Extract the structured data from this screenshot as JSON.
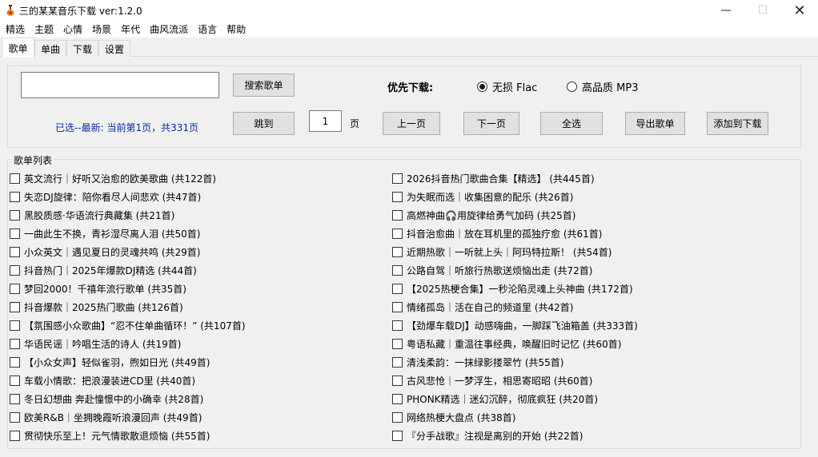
{
  "window": {
    "title": "三的某某音乐下载 ver:1.2.0",
    "min_glyph": "—",
    "max_glyph": "☐",
    "close_glyph": "✕",
    "icon": "guitar-app-icon"
  },
  "menu": [
    "精选",
    "主题",
    "心情",
    "场景",
    "年代",
    "曲风流派",
    "语言",
    "帮助"
  ],
  "tabs": [
    {
      "label": "歌单",
      "active": true
    },
    {
      "label": "单曲",
      "active": false
    },
    {
      "label": "下载",
      "active": false
    },
    {
      "label": "设置",
      "active": false
    }
  ],
  "search": {
    "value": "",
    "button": "搜索歌单"
  },
  "priority": {
    "label": "优先下载:",
    "options": [
      {
        "label": "无损 Flac",
        "checked": true
      },
      {
        "label": "高品质 MP3",
        "checked": false
      }
    ]
  },
  "status": "已选--最新:  当前第1页，共331页",
  "pager": {
    "jump": "跳到",
    "page_value": "1",
    "page_unit": "页",
    "prev": "上一页",
    "next": "下一页",
    "select_all": "全选",
    "export": "导出歌单",
    "add_download": "添加到下载"
  },
  "playlist_group": {
    "title": "歌单列表",
    "left": [
      "英文流行｜好听又治愈的欧美歌曲 (共122首)",
      "失恋DJ旋律：陪你看尽人间悲欢 (共47首)",
      "黑胶质感·华语流行典藏集 (共21首)",
      "一曲此生不换，青衫湿尽离人泪 (共50首)",
      "小众英文｜遇见夏日的灵魂共鸣 (共29首)",
      "抖音热门｜2025年爆款DJ精选 (共44首)",
      "梦回2000！千禧年流行歌单 (共35首)",
      "抖音爆款｜2025热门歌曲 (共126首)",
      "【氛围感小众歌曲】“忍不住单曲循环！” (共107首)",
      "华语民谣｜吟唱生活的诗人 (共19首)",
      "【小众女声】轻似雀羽，煦如日光 (共49首)",
      "车载小情歌：把浪漫装进CD里 (共40首)",
      "冬日幻想曲 奔赴憧憬中的小确幸 (共28首)",
      "欧美R&B｜坐拥晚霞听浪漫回声 (共49首)",
      "贯彻快乐至上！元气情歌散退烦恼 (共55首)"
    ],
    "right": [
      "2026抖音热门歌曲合集【精选】 (共445首)",
      "为失眠而选｜收集困意的配乐 (共26首)",
      "高燃神曲🎧用旋律给勇气加码 (共25首)",
      "抖音治愈曲｜放在耳机里的孤独疗愈 (共61首)",
      "近期热歌｜一听就上头｜阿玛特拉斯！ (共54首)",
      "公路自驾｜听旅行热歌送烦恼出走 (共72首)",
      "【2025热梗合集】一秒沦陷灵魂上头神曲 (共172首)",
      "情绪孤岛｜活在自己的频道里 (共42首)",
      "【劲爆车载DJ】动感嗨曲，一脚踩飞油箱盖 (共333首)",
      "粤语私藏｜重温往事经典，唤醒旧时记忆 (共60首)",
      "清浅柔韵：一抹绿影搂翠竹 (共55首)",
      "古风悲怆｜一梦浮生，相思寄昭昭 (共60首)",
      "PHONK精选｜迷幻沉醉，彻底疯狂 (共20首)",
      "网络热梗大盘点 (共38首)",
      "『分手战歌』注视是离别的开始 (共22首)"
    ]
  }
}
